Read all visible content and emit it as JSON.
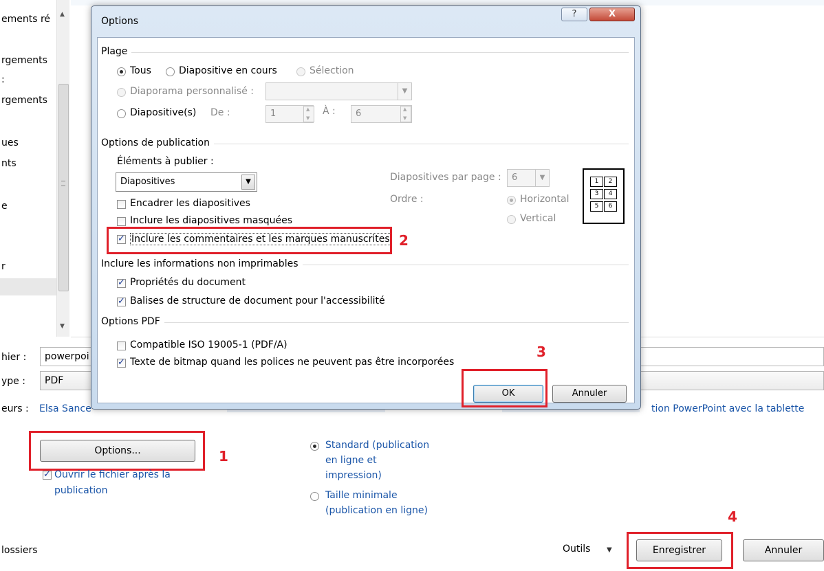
{
  "left_nav": {
    "items": [
      "ements ré",
      "rgements",
      ":",
      "rgements",
      "ues",
      "nts",
      "e",
      "r"
    ]
  },
  "bottom": {
    "filename_label": "hier :",
    "filename_value": "powerpoi",
    "type_label": "ype :",
    "type_value": "PDF",
    "authors_label": "eurs :",
    "authors_value": "Elsa Sance",
    "tags_value": "tion PowerPoint avec la tablette",
    "options_button": "Options...",
    "open_after_label_1": "Ouvrir le fichier après la",
    "open_after_label_2": "publication",
    "standard_line_1": "Standard (publication",
    "standard_line_2": "en ligne et",
    "standard_line_3": "impression)",
    "minimal_line_1": "Taille minimale",
    "minimal_line_2": "(publication en ligne)",
    "folders_label": "lossiers",
    "tools_label": "Outils",
    "save_button": "Enregistrer",
    "cancel_button": "Annuler"
  },
  "dialog": {
    "title": "Options",
    "help_glyph": "?",
    "close_glyph": "X",
    "range": {
      "title": "Plage",
      "all": "Tous",
      "current": "Diapositive en cours",
      "selection": "Sélection",
      "custom_show": "Diaporama personnalisé :",
      "slides": "Diapositive(s)",
      "from": "De :",
      "from_value": "1",
      "to": "À :",
      "to_value": "6"
    },
    "publish": {
      "title": "Options de publication",
      "what_label": "Éléments à publier :",
      "what_value": "Diapositives",
      "frame": "Encadrer les diapositives",
      "hidden": "Inclure les diapositives masquées",
      "comments": "Inclure les commentaires et les marques manuscrites",
      "per_page_label": "Diapositives par page :",
      "per_page_value": "6",
      "order_label": "Ordre :",
      "horizontal": "Horizontal",
      "vertical": "Vertical",
      "preview_numbers": [
        "1",
        "2",
        "3",
        "4",
        "5",
        "6"
      ]
    },
    "nonprint": {
      "title": "Inclure les informations non imprimables",
      "props": "Propriétés du document",
      "tags": "Balises de structure de document pour l'accessibilité"
    },
    "pdf": {
      "title": "Options PDF",
      "iso": "Compatible ISO 19005-1 (PDF/A)",
      "bitmap": "Texte de bitmap quand les polices ne peuvent pas être incorporées"
    },
    "ok_button": "OK",
    "cancel_button": "Annuler"
  },
  "annotations": [
    "1",
    "2",
    "3",
    "4"
  ],
  "colors": {
    "annotation_red": "#e0202a",
    "link_blue": "#1a55a8"
  }
}
